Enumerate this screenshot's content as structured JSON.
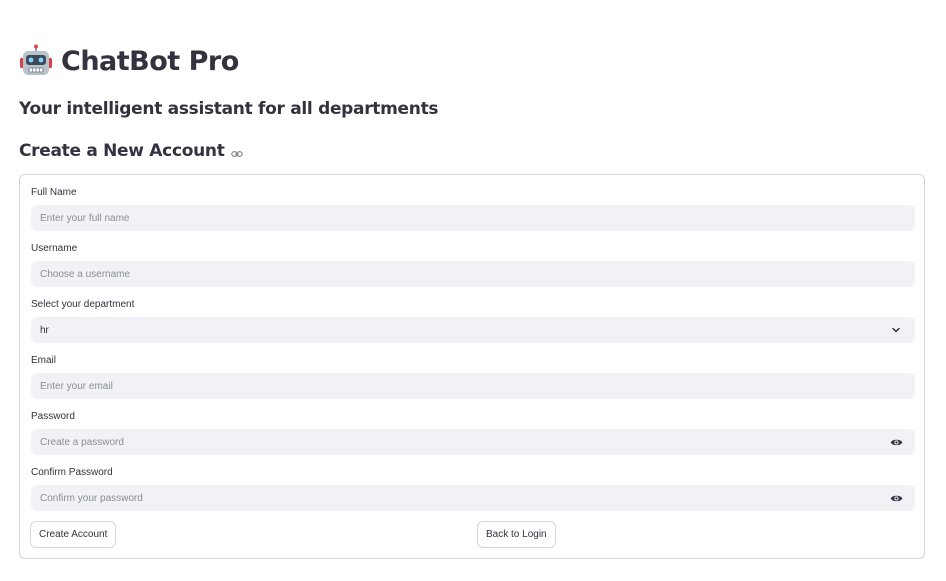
{
  "app": {
    "icon": "robot-icon",
    "title": "ChatBot Pro",
    "subtitle": "Your intelligent assistant for all departments"
  },
  "section": {
    "title": "Create a New Account",
    "anchor_icon": "link-icon"
  },
  "form": {
    "full_name": {
      "label": "Full Name",
      "placeholder": "Enter your full name"
    },
    "username": {
      "label": "Username",
      "placeholder": "Choose a username"
    },
    "department": {
      "label": "Select your department",
      "value": "hr",
      "icon": "chevron-down-icon"
    },
    "email": {
      "label": "Email",
      "placeholder": "Enter your email"
    },
    "password": {
      "label": "Password",
      "placeholder": "Create a password",
      "icon": "eye-icon"
    },
    "confirm_password": {
      "label": "Confirm Password",
      "placeholder": "Confirm your password",
      "icon": "eye-icon"
    },
    "create_button": "Create Account",
    "back_button": "Back to Login"
  }
}
